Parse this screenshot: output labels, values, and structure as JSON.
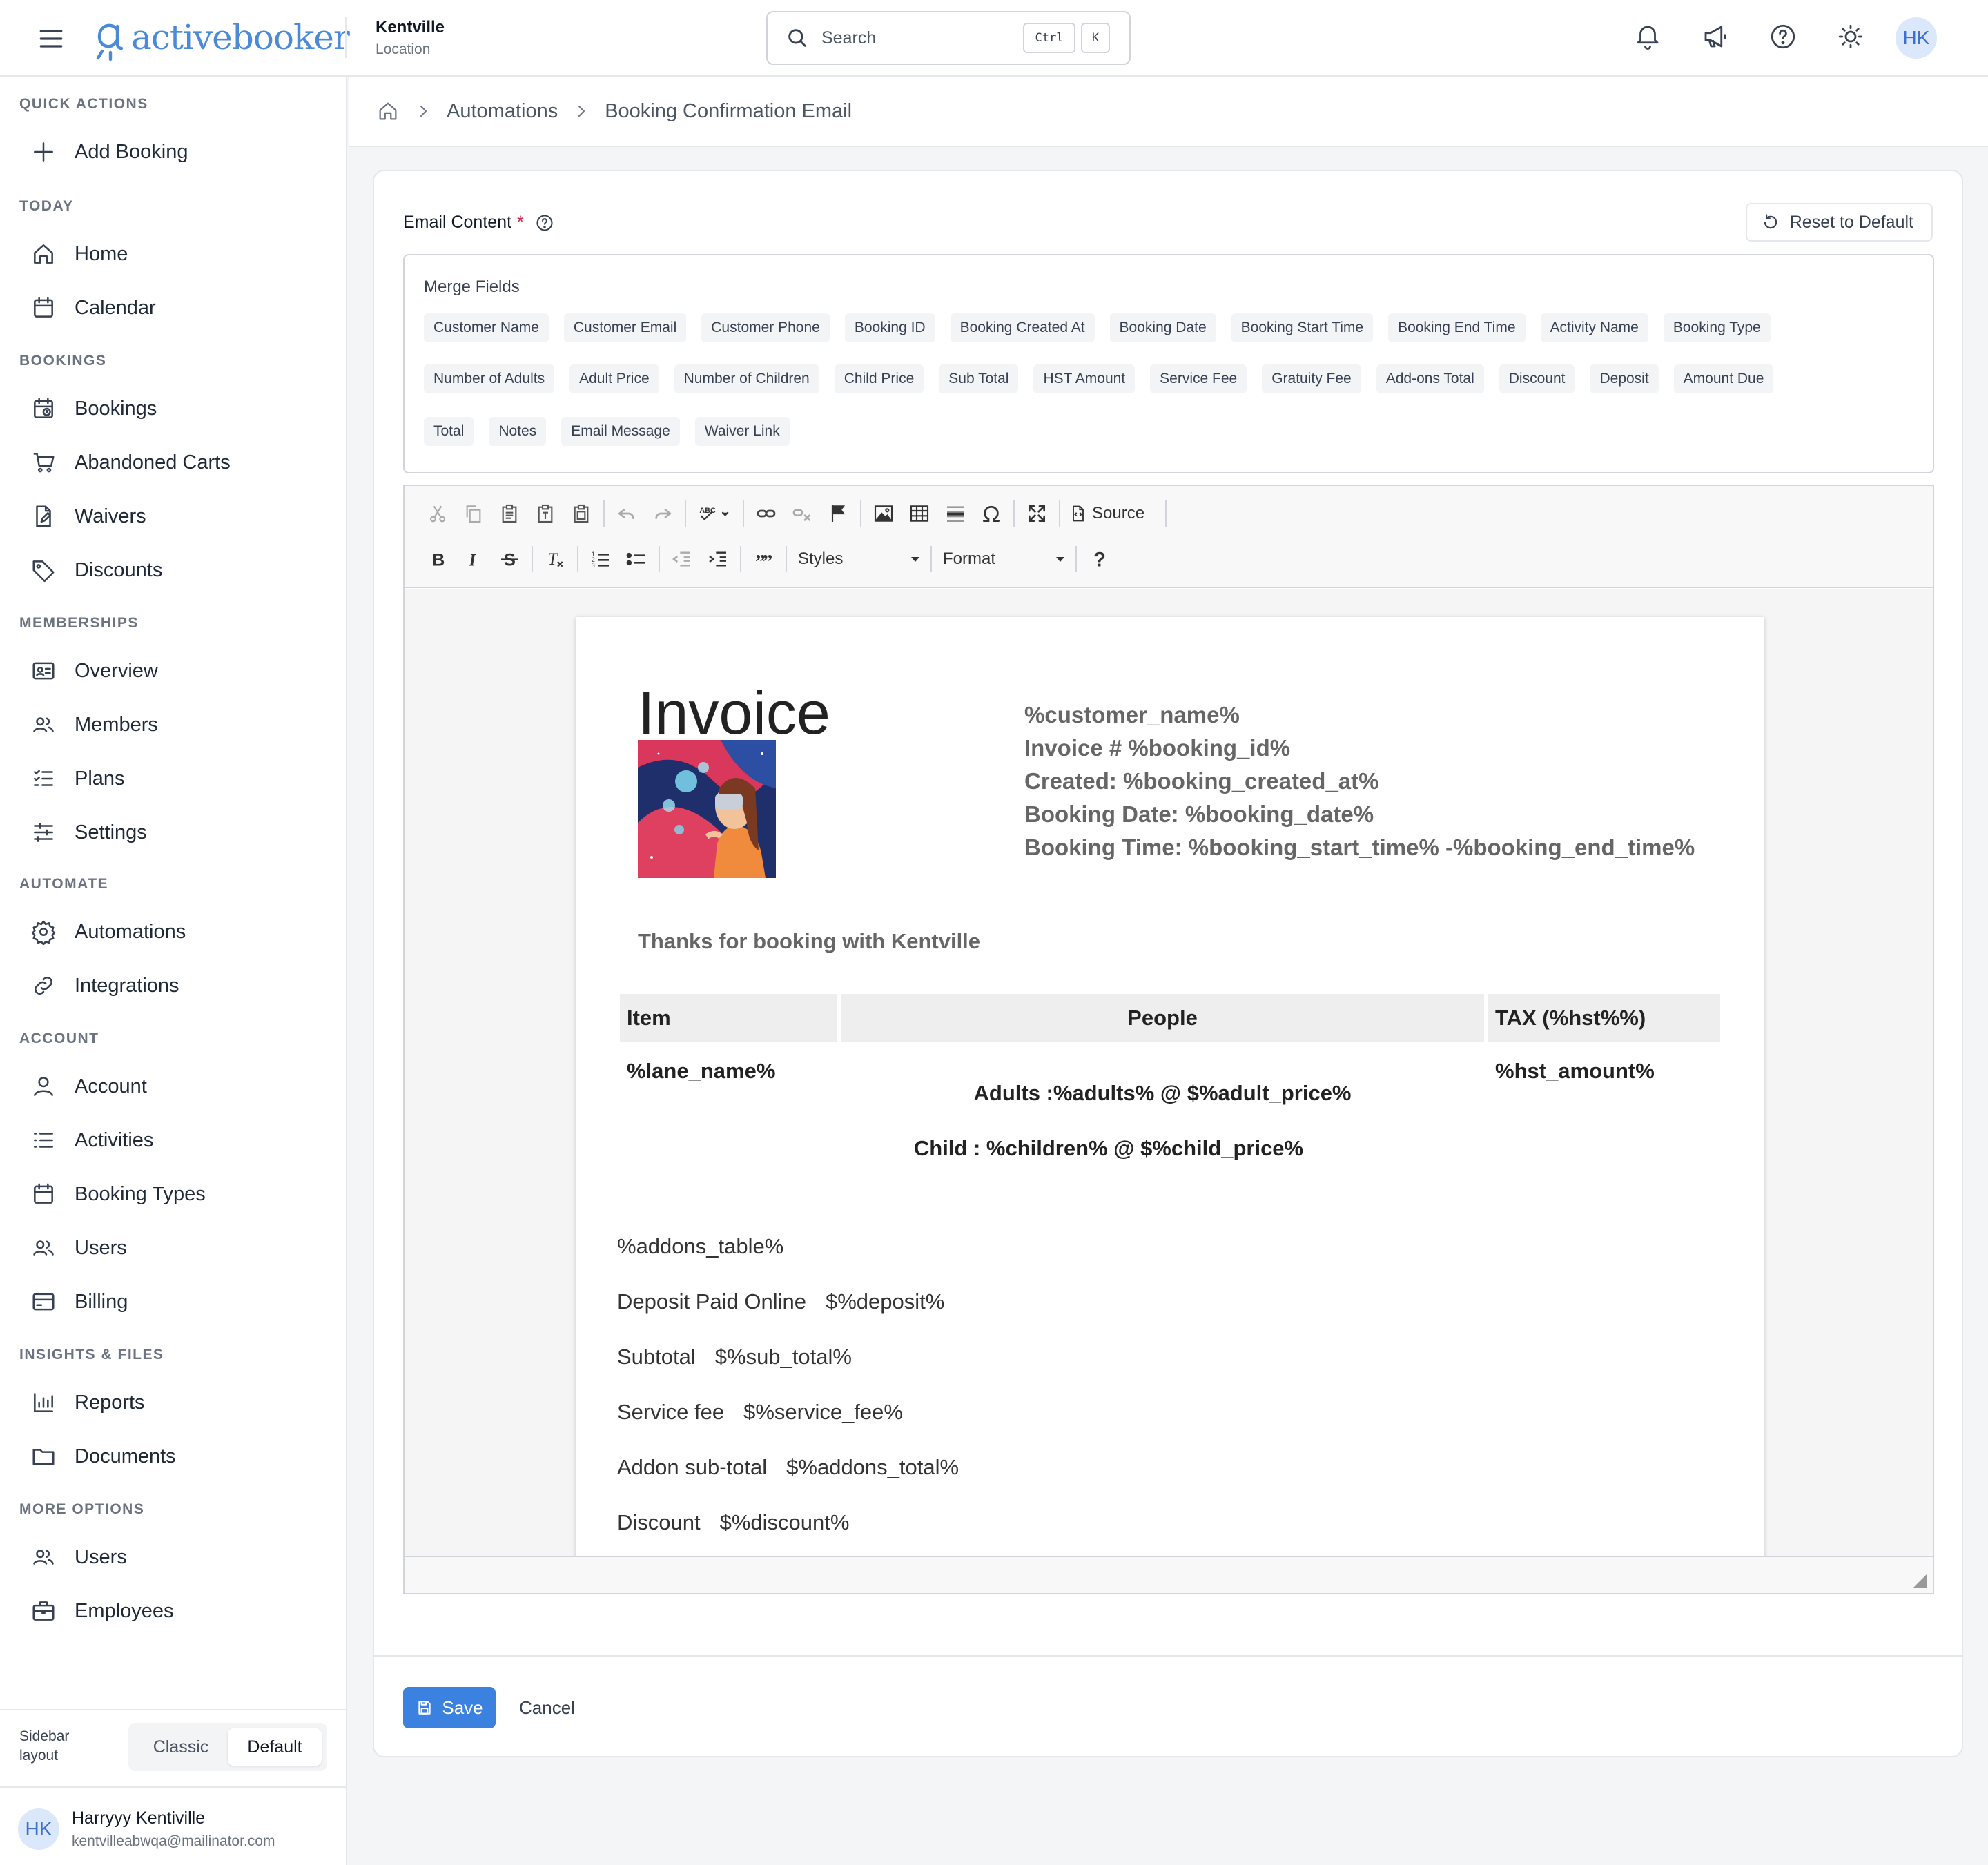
{
  "app": {
    "logo_text": "activebooker",
    "location_name": "Kentville",
    "location_sub": "Location"
  },
  "search": {
    "placeholder": "Search",
    "kbd_ctrl": "Ctrl",
    "kbd_k": "K"
  },
  "topbar": {
    "avatar_initials": "HK"
  },
  "sidebar": {
    "sections": {
      "quick_actions": "QUICK ACTIONS",
      "today": "TODAY",
      "bookings": "BOOKINGS",
      "memberships": "MEMBERSHIPS",
      "automate": "AUTOMATE",
      "account": "ACCOUNT",
      "insights": "INSIGHTS & FILES",
      "more": "MORE OPTIONS"
    },
    "items": {
      "add_booking": "Add Booking",
      "home": "Home",
      "calendar": "Calendar",
      "bookings": "Bookings",
      "abandoned_carts": "Abandoned Carts",
      "waivers": "Waivers",
      "discounts": "Discounts",
      "overview": "Overview",
      "members": "Members",
      "plans": "Plans",
      "settings": "Settings",
      "automations": "Automations",
      "integrations": "Integrations",
      "account": "Account",
      "activities": "Activities",
      "booking_types": "Booking Types",
      "users": "Users",
      "billing": "Billing",
      "reports": "Reports",
      "documents": "Documents",
      "users_more": "Users",
      "employees": "Employees"
    },
    "layout_label_1": "Sidebar",
    "layout_label_2": "layout",
    "layout_classic": "Classic",
    "layout_default": "Default",
    "user_initials": "HK",
    "user_name": "Harryyy Kentiville",
    "user_email": "kentvilleabwqa@mailinator.com"
  },
  "breadcrumb": {
    "level1": "Automations",
    "level2": "Booking Confirmation Email"
  },
  "form": {
    "email_content_label": "Email Content",
    "required_mark": "*",
    "reset_button": "Reset to Default",
    "merge_fields_title": "Merge Fields",
    "merge_fields_row1": [
      "Customer Name",
      "Customer Email",
      "Customer Phone",
      "Booking ID",
      "Booking Created At",
      "Booking Date",
      "Booking Start Time",
      "Booking End Time",
      "Activity Name",
      "Booking Type"
    ],
    "merge_fields_row2": [
      "Number of Adults",
      "Adult Price",
      "Number of Children",
      "Child Price",
      "Sub Total",
      "HST Amount",
      "Service Fee",
      "Gratuity Fee",
      "Add-ons Total",
      "Discount",
      "Deposit",
      "Amount Due"
    ],
    "merge_fields_row3": [
      "Total",
      "Notes",
      "Email Message",
      "Waiver Link"
    ],
    "save_button": "Save",
    "cancel_button": "Cancel"
  },
  "editor": {
    "source_label": "Source",
    "styles_combo": "Styles",
    "format_combo": "Format"
  },
  "invoice": {
    "title": "Invoice",
    "meta_customer": "%customer_name%",
    "meta_invoice": "Invoice # %booking_id%",
    "meta_created": "Created: %booking_created_at%",
    "meta_date": "Booking Date: %booking_date%",
    "meta_time": "Booking Time: %booking_start_time% -%booking_end_time%",
    "thanks": "Thanks for booking with Kentville",
    "col_item": "Item",
    "col_people": "People",
    "col_tax": "TAX (%hst%%)",
    "cell_item": "%lane_name%",
    "cell_adults": "Adults :%adults% @ $%adult_price%",
    "cell_child": "Child : %children% @ $%child_price%",
    "cell_tax": "%hst_amount%",
    "addons_table": "%addons_table%",
    "summary": [
      {
        "label": "Deposit Paid Online",
        "value": "$%deposit%"
      },
      {
        "label": "Subtotal",
        "value": "$%sub_total%"
      },
      {
        "label": "Service fee",
        "value": "$%service_fee%"
      },
      {
        "label": "Addon sub-total",
        "value": "$%addons_total%"
      },
      {
        "label": "Discount",
        "value": "$%discount%"
      }
    ]
  }
}
